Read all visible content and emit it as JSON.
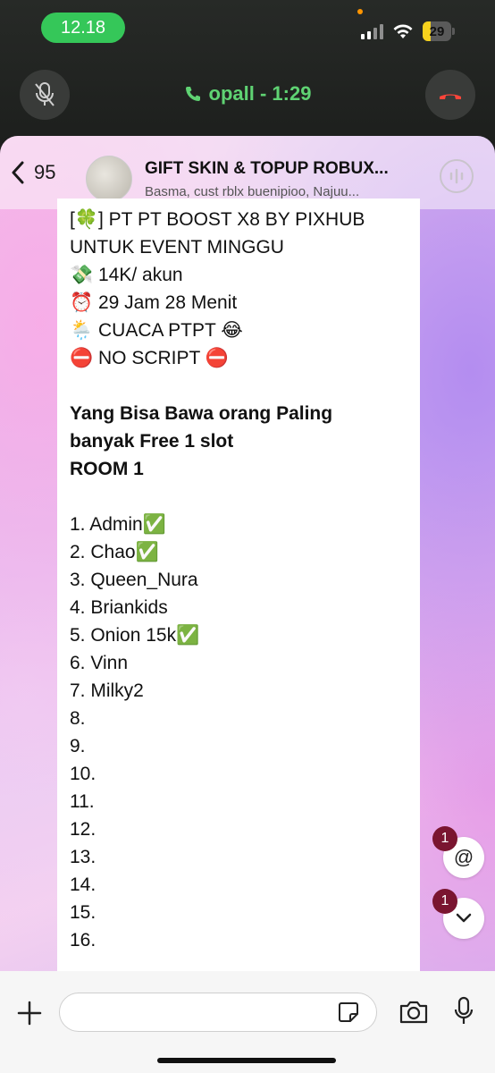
{
  "status_bar": {
    "time": "12.18",
    "battery": "29",
    "battery_level": 0.29
  },
  "call": {
    "label": "opall - 1:29"
  },
  "header": {
    "back_count": "95",
    "group_name": "GIFT SKIN & TOPUP ROBUX...",
    "members": "Basma, cust rblx buenipioo, Najuu..."
  },
  "message": {
    "lines": [
      "[🍀] PT PT BOOST X8 BY PIXHUB",
      "UNTUK EVENT MINGGU",
      "💸 14K/ akun",
      "⏰ 29 Jam 28 Menit",
      "🌦️ CUACA PTPT 😂",
      "⛔ NO SCRIPT ⛔"
    ],
    "bold_lines": [
      "Yang Bisa Bawa orang Paling",
      "banyak Free 1 slot",
      "ROOM 1"
    ],
    "list": [
      "1. Admin✅",
      "2. Chao✅",
      "3. Queen_Nura",
      "4. Briankids",
      "5. Onion 15k✅",
      "6. Vinn",
      "7. Milky2",
      "8.",
      "9.",
      "10.",
      "11.",
      "12.",
      "13.",
      "14.",
      "15.",
      "16."
    ]
  },
  "mentions": {
    "badge": "1",
    "icon": "@"
  },
  "scroll_down": {
    "badge": "1"
  },
  "icons": {
    "mic_muted": "mic-off-icon",
    "call": "phone-icon",
    "end_call": "end-call-icon",
    "back": "chevron-left-icon",
    "voice_chat": "voice-chat-icon",
    "attach": "plus-icon",
    "sticker": "sticker-icon",
    "camera": "camera-icon",
    "mic": "mic-icon"
  },
  "colors": {
    "call_green": "#35c759",
    "badge": "#7a1530",
    "battery": "#f7d21d"
  }
}
